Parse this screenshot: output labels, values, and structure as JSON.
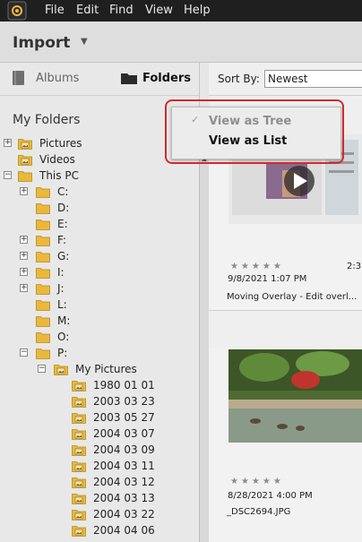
{
  "menubar": {
    "app_icon": "photoshop-elements-logo-icon",
    "items": [
      "File",
      "Edit",
      "Find",
      "View",
      "Help"
    ]
  },
  "header": {
    "title": "Import",
    "caret_icon": "dropdown-caret-icon"
  },
  "left_panel": {
    "tabs": [
      {
        "label": "Albums",
        "icon": "album-icon",
        "active": false
      },
      {
        "label": "Folders",
        "icon": "folder-icon",
        "active": true
      }
    ],
    "section_title": "My Folders",
    "tree": [
      {
        "label": "Pictures",
        "expander": "+"
      },
      {
        "label": "Videos",
        "expander": ""
      },
      {
        "label": "This PC",
        "expander": "-"
      },
      {
        "label": "C:",
        "expander": "+"
      },
      {
        "label": "D:",
        "expander": ""
      },
      {
        "label": "E:",
        "expander": ""
      },
      {
        "label": "F:",
        "expander": "+"
      },
      {
        "label": "G:",
        "expander": "+"
      },
      {
        "label": "I:",
        "expander": "+"
      },
      {
        "label": "J:",
        "expander": "+"
      },
      {
        "label": "L:",
        "expander": ""
      },
      {
        "label": "M:",
        "expander": ""
      },
      {
        "label": "O:",
        "expander": ""
      },
      {
        "label": "P:",
        "expander": "-"
      },
      {
        "label": "My Pictures",
        "expander": "-"
      },
      {
        "label": "1980 01 01",
        "expander": ""
      },
      {
        "label": "2003 03 23",
        "expander": ""
      },
      {
        "label": "2003 05 27",
        "expander": ""
      },
      {
        "label": "2004 03 07",
        "expander": ""
      },
      {
        "label": "2004 03 09",
        "expander": ""
      },
      {
        "label": "2004 03 11",
        "expander": ""
      },
      {
        "label": "2004 03 12",
        "expander": ""
      },
      {
        "label": "2004 03 13",
        "expander": ""
      },
      {
        "label": "2004 03 22",
        "expander": ""
      },
      {
        "label": "2004 04 06",
        "expander": ""
      }
    ]
  },
  "sort": {
    "label": "Sort By:",
    "value": "Newest"
  },
  "view_menu": {
    "options": [
      {
        "label": "View as Tree",
        "checked": true
      },
      {
        "label": "View as List",
        "checked": false
      }
    ]
  },
  "media": [
    {
      "date": "9/8/2021 1:07 PM",
      "duration": "2:3",
      "caption": "Moving Overlay - Edit overl...",
      "rating": 0
    },
    {
      "date": "8/28/2021 4:00 PM",
      "duration": "",
      "caption": "_DSC2694.JPG",
      "rating": 0
    }
  ],
  "colors": {
    "menubar": "#1f1f1f",
    "highlight": "#d42a2a",
    "folder": "#e8b93a"
  }
}
